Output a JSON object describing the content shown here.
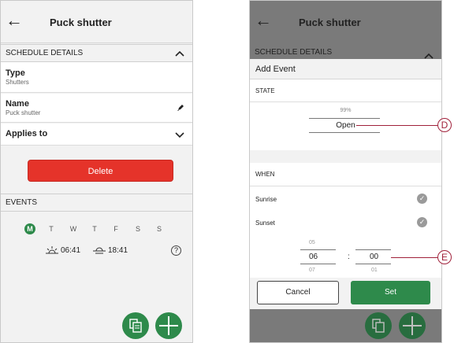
{
  "left": {
    "header": {
      "back_icon": "arrow-left-icon",
      "title": "Puck shutter"
    },
    "schedule_details_label": "SCHEDULE DETAILS",
    "type": {
      "label": "Type",
      "value": "Shutters"
    },
    "name": {
      "label": "Name",
      "value": "Puck shutter",
      "edit_icon": "pencil-icon"
    },
    "applies_to": {
      "label": "Applies to"
    },
    "delete_label": "Delete",
    "events_label": "EVENTS",
    "days": [
      "M",
      "T",
      "W",
      "T",
      "F",
      "S",
      "S"
    ],
    "active_day_index": 0,
    "sunrise_time": "06:41",
    "sunset_time": "18:41",
    "help_glyph": "?",
    "colors": {
      "delete": "#e5332a",
      "accent": "#2e8a4b"
    }
  },
  "right": {
    "header": {
      "back_icon": "arrow-left-icon",
      "title": "Puck shutter"
    },
    "schedule_details_label": "SCHEDULE DETAILS",
    "sheet_title": "Add Event",
    "state_label": "STATE",
    "state_above": "99%",
    "state_selected": "Open",
    "when_label": "WHEN",
    "options": [
      {
        "label": "Sunrise",
        "checked": true
      },
      {
        "label": "Sunset",
        "checked": true
      }
    ],
    "time_above": {
      "hour": "05"
    },
    "time_selected": {
      "hour": "06",
      "sep": ":",
      "minute": "00"
    },
    "time_below": {
      "hour": "07",
      "minute": "01"
    },
    "cancel_label": "Cancel",
    "set_label": "Set"
  },
  "callouts": {
    "d": "D",
    "e": "E"
  }
}
